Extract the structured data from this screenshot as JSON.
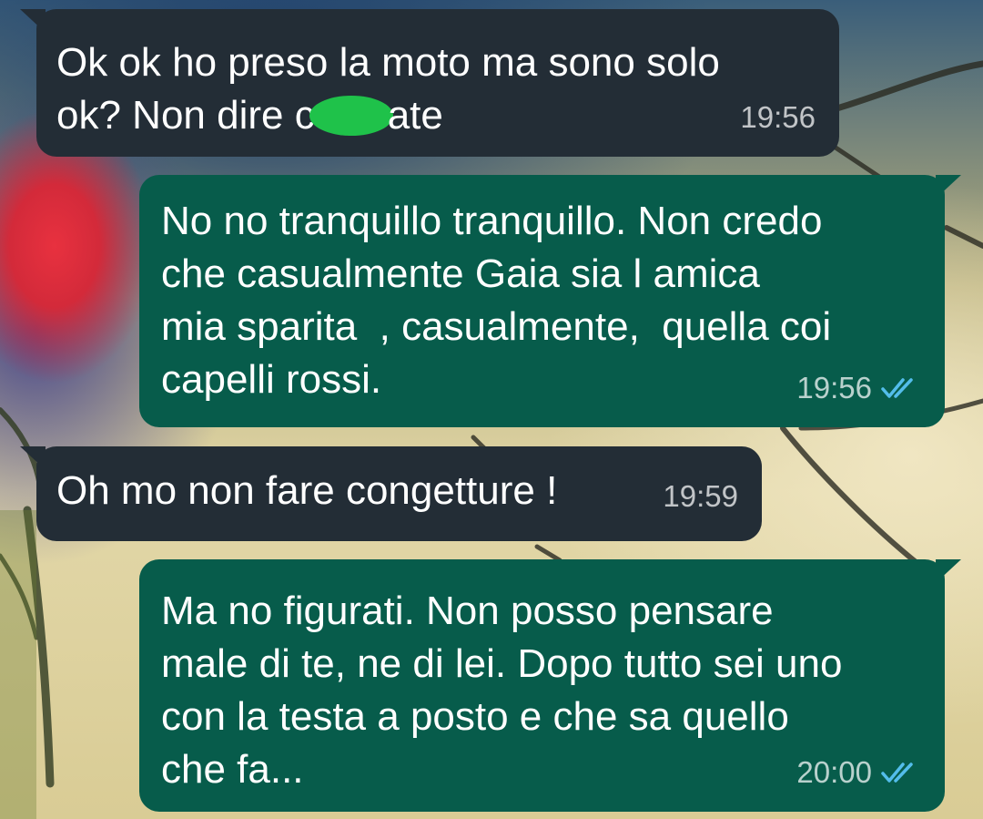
{
  "messages": [
    {
      "direction": "incoming",
      "text_before": "Ok ok ho preso la moto ma sono solo\nok? Non dire c",
      "text_after": "ate",
      "time": "19:56"
    },
    {
      "direction": "outgoing",
      "text": "No no tranquillo tranquillo. Non credo\nche casualmente Gaia sia l amica\nmia sparita  , casualmente,  quella coi\ncapelli rossi.",
      "time": "19:56",
      "status": "read"
    },
    {
      "direction": "incoming",
      "text": "Oh mo non fare congetture !",
      "time": "19:59"
    },
    {
      "direction": "outgoing",
      "text": "Ma no figurati. Non posso pensare\nmale di te, ne di lei. Dopo tutto sei uno\ncon la testa a posto e che sa quello\nche fa...",
      "time": "20:00",
      "status": "read"
    }
  ],
  "colors": {
    "incoming_bubble": "#232d36",
    "outgoing_bubble": "#075c4b",
    "read_ticks": "#53bdeb",
    "redaction": "#1fc24a"
  },
  "icons": {
    "read_receipt": "double-check-icon"
  }
}
